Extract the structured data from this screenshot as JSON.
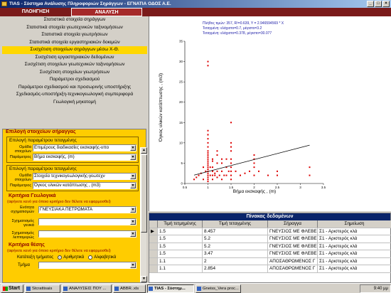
{
  "window": {
    "title": "TIAS - Σύστημα Ανάλυσης Πληροφοριών Σηράγγων - ΕΓΝΑΤΙΑ ΟΔΟΣ Α.Ε."
  },
  "tabs": [
    "ΠΛΟΗΓΗΣΗ",
    "ΑΝΑΛΥΣΗ"
  ],
  "menu": [
    "Στατιστικά στοιχεία σηράγγων",
    "Στατιστικά στοιχεία γεωτεχνικών ταξινομήσεων",
    "Στατιστικά στοιχεία γεωτρήσεων",
    "Στατιστικά στοιχεία εργαστηριακών δοκιμών",
    "Συσχέτιση στοιχείων σηράγγων μέσω Χ-Θ.",
    "Συσχέτιση εργαστηριακών δεδομένων",
    "Συσχέτιση στοιχείων γεωτεχνικών ταξινομήσεων",
    "Συσχέτιση στοιχείων γεωτρήσεων",
    "Παράμετροι σχεδιασμού",
    "Παράμετροι σχεδιασμού και προσωρινής υποστήριξης",
    "Σχεδιασμός-υποστήριξη-τεχνικογεωλογική συμπεριφορά",
    "Γεωλογική μηκοτομή"
  ],
  "menu_active_index": 4,
  "options": {
    "section_title": "Επιλογή στοιχείων σήραγγας",
    "group1": {
      "title": "Επιλογή παραμέτρου τεταγμένης",
      "group_label": "Ομάδα στοιχείων",
      "group_value": "Επιμέρους διαδικασίες εκσκαφής-υπο",
      "param_label": "Παράμετρος",
      "param_value": "Βήμα εκσκαφής, (m)"
    },
    "group2": {
      "title": "Επιλογή παραμέτρου τεταγμένης",
      "group_label": "Ομάδα στοιχείων",
      "group_value": "Στοιχεία τεχνικογεωλογικής-γεωτεχν",
      "param_label": "Παράμετρος",
      "param_value": "Όγκος υλικών κατάπτωσης , (m3)"
    },
    "geo_title": "Κριτήρια Γεωλογικά",
    "geo_note": "(αφήνετε κενό για όποιο κριτήριο δεν θέλετε να εφαρμοσθεί)",
    "unit_label": "Ενότητα σχηματισμών",
    "unit_value": "ΓΝΕΥΣΙΑΚΑ ΠΕΤΡΩΜΑΤΑ",
    "form_gen_label": "Σχηματισμός γενικά",
    "form_det_label": "Σχηματισμός λεπτομερώς",
    "pos_title": "Κριτήρια θέσης",
    "pos_note": "(αφήνετε κενό για όποιο κριτήριο δεν θέλετε να εφαρμοσθεί)",
    "position_label": "Κατάταξη τμήματος",
    "radio_numeric": "Αριθμητικά",
    "radio_alpha": "Αλφαβητικά",
    "segment_label": "Τμήμα"
  },
  "chart_data": {
    "type": "scatter",
    "annotation": [
      "Πλήθος τιμών: 357, R²=0.639, Y = 2.946594569 * X",
      "Τεταγμένη: ελάχιστο=0.7, μέγιστο=3.2",
      "Τεταγμένη: ελάχιστο=0.378, μέγιστο=30.077"
    ],
    "xlabel": "Βήμα εκσκαφής , (m)",
    "ylabel": "Όγκος υλικών κατάπτωσης , (m3)",
    "xlim": [
      0.5,
      3.5
    ],
    "ylim": [
      0,
      35
    ],
    "xticks": [
      "0.5",
      "1",
      "1.5",
      "2",
      "2.5",
      "3",
      "3.5"
    ],
    "yticks": [
      "0",
      "5",
      "10",
      "15",
      "20",
      "25",
      "30",
      "35"
    ],
    "trend": {
      "x": [
        0.7,
        3.2
      ],
      "y": [
        2.06,
        9.43
      ]
    },
    "points": {
      "x": [
        0.7,
        0.75,
        0.8,
        0.85,
        0.9,
        0.95,
        1,
        1,
        1,
        1,
        1,
        1,
        1,
        1,
        1,
        1,
        1,
        1,
        1,
        1,
        1,
        1,
        1,
        1,
        1,
        1,
        1,
        1.05,
        1.05,
        1.1,
        1.1,
        1.1,
        1.1,
        1.1,
        1.15,
        1.2,
        1.2,
        1.2,
        1.2,
        1.25,
        1.3,
        1.3,
        1.3,
        1.35,
        1.4,
        1.4,
        1.45,
        1.5,
        1.5,
        1.5,
        1.5,
        1.5,
        1.5,
        1.5,
        1.5,
        1.6,
        1.7,
        1.8,
        1.9,
        2,
        2,
        2,
        2.1,
        2.3,
        2.5,
        2.5,
        3.2,
        3.2,
        1,
        1,
        1,
        1.15,
        1.3,
        1.5,
        1.5,
        2,
        2,
        1.2,
        1.4,
        0.9,
        1,
        1.1
      ],
      "y": [
        1,
        1.5,
        2,
        2.5,
        1,
        3,
        0.5,
        1,
        1.5,
        2,
        2.5,
        3,
        3.5,
        4,
        4.5,
        5,
        5.5,
        6,
        6.5,
        7,
        7.5,
        8,
        9,
        10,
        12,
        29,
        30,
        2,
        4,
        1,
        2,
        3,
        4,
        6,
        2,
        1.5,
        3,
        5,
        7,
        2,
        1,
        3,
        5,
        2,
        2,
        4,
        3,
        1,
        2,
        3,
        4,
        5,
        6,
        8,
        15,
        3,
        2,
        2.5,
        3,
        2,
        4,
        6,
        3,
        2,
        2,
        3,
        2,
        4,
        11,
        12,
        13,
        2.5,
        6,
        9,
        10,
        5,
        7,
        8,
        6,
        4,
        3.5,
        5.5
      ]
    }
  },
  "table": {
    "caption": "Πίνακας δεδομένων",
    "headers": [
      "Τιμή τετμημένης",
      "Τιμή τεταγμένης",
      "Σήραγγα",
      "Σημείωση"
    ],
    "rows": [
      [
        "1.5",
        "8.457",
        "ΓΝΕΥΣΙΟΣ ΜΕ ΦΛΕΒΕ",
        "Σ1 - Αριστερός κλά"
      ],
      [
        "1.5",
        "5.2",
        "ΓΝΕΥΣΙΟΣ ΜΕ ΦΛΕΒΕ",
        "Σ1 - Αριστερός κλά"
      ],
      [
        "1.5",
        "5.2",
        "ΓΝΕΥΣΙΟΣ ΜΕ ΦΛΕΒΕ",
        "Σ1 - Αριστερός κλά"
      ],
      [
        "1.5",
        "3.47",
        "ΓΝΕΥΣΙΟΣ ΜΕ ΦΛΕΒΕ",
        "Σ1 - Αριστερός κλά"
      ],
      [
        "1.1",
        "2",
        "ΑΠΟΣΑΘΡΩΜΕΝΟΣ Γ",
        "Σ1 - Αριστερός κλά"
      ],
      [
        "1.1",
        "2.854",
        "ΑΠΟΣΑΘΡΩΜΕΝΟΣ Γ",
        "Σ1 - Αριστερός κλά"
      ]
    ]
  },
  "taskbar": {
    "start": "Start",
    "items": [
      "Stcrattisais",
      "ΑΝΑΛΥΣΕΙΣ ΠΟΥ ...",
      "ABBR..xls",
      "TIAS - Σύστημ...",
      "Gneiss_Vera proc..."
    ],
    "active_index": 3,
    "clock": "9:40 μμ"
  },
  "colors": {
    "title_bar": "#0a246a",
    "tab_bar": "#7a1a1a",
    "active_menu": "#ffd700",
    "options_panel": "#ffcc00",
    "point": "#dd0000"
  }
}
